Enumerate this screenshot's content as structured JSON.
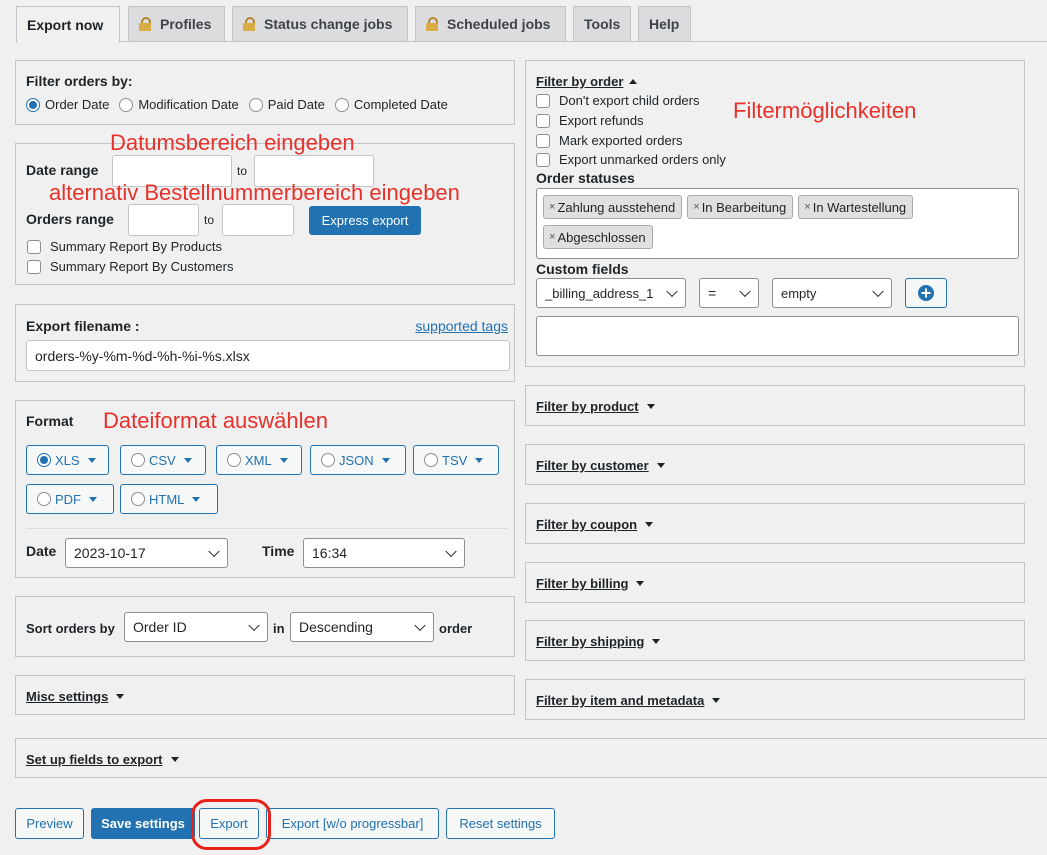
{
  "tabs": [
    {
      "label": "Export now",
      "locked": false,
      "active": true
    },
    {
      "label": "Profiles",
      "locked": true
    },
    {
      "label": "Status change jobs",
      "locked": true
    },
    {
      "label": "Scheduled jobs",
      "locked": true
    },
    {
      "label": "Tools",
      "locked": false
    },
    {
      "label": "Help",
      "locked": false
    }
  ],
  "filter_orders": {
    "title": "Filter orders by:",
    "options": [
      "Order Date",
      "Modification Date",
      "Paid Date",
      "Completed Date"
    ],
    "selected": "Order Date"
  },
  "range": {
    "date_label": "Date range",
    "to": "to",
    "orders_label": "Orders range",
    "express_button": "Express export",
    "summary_products": "Summary Report By Products",
    "summary_customers": "Summary Report By Customers"
  },
  "filename": {
    "label": "Export filename :",
    "tags_link": "supported tags",
    "value": "orders-%y-%m-%d-%h-%i-%s.xlsx"
  },
  "format": {
    "label": "Format",
    "options": [
      "XLS",
      "CSV",
      "XML",
      "JSON",
      "TSV",
      "PDF",
      "HTML"
    ],
    "selected": "XLS",
    "date_label": "Date",
    "date_value": "2023-10-17",
    "time_label": "Time",
    "time_value": "16:34"
  },
  "sort": {
    "label": "Sort orders by",
    "field": "Order ID",
    "in": "in",
    "direction": "Descending",
    "order": "order"
  },
  "misc": {
    "label": "Misc settings"
  },
  "fields_setup": {
    "label": "Set up fields to export"
  },
  "filter_by_order": {
    "title": "Filter by order",
    "checks": [
      "Don't export child orders",
      "Export refunds",
      "Mark exported orders",
      "Export unmarked orders only"
    ],
    "statuses_label": "Order statuses",
    "statuses": [
      "Zahlung ausstehend",
      "In Bearbeitung",
      "In Wartestellung",
      "Abgeschlossen"
    ],
    "custom_label": "Custom fields",
    "custom_field": "_billing_address_1",
    "custom_op": "=",
    "custom_value": "empty"
  },
  "filters": [
    "Filter by product",
    "Filter by customer",
    "Filter by coupon",
    "Filter by billing",
    "Filter by shipping",
    "Filter by item and metadata"
  ],
  "buttons": {
    "preview": "Preview",
    "save": "Save settings",
    "export": "Export",
    "export_no_progress": "Export [w/o progressbar]",
    "reset": "Reset settings"
  },
  "annotations": {
    "date_range": "Datumsbereich eingeben",
    "order_range": "alternativ Bestellnummerbereich eingeben",
    "file_format": "Dateiformat auswählen",
    "filter_options": "Filtermöglichkeiten"
  },
  "colors": {
    "accent": "#2271b1",
    "annotation": "#e8312a"
  }
}
